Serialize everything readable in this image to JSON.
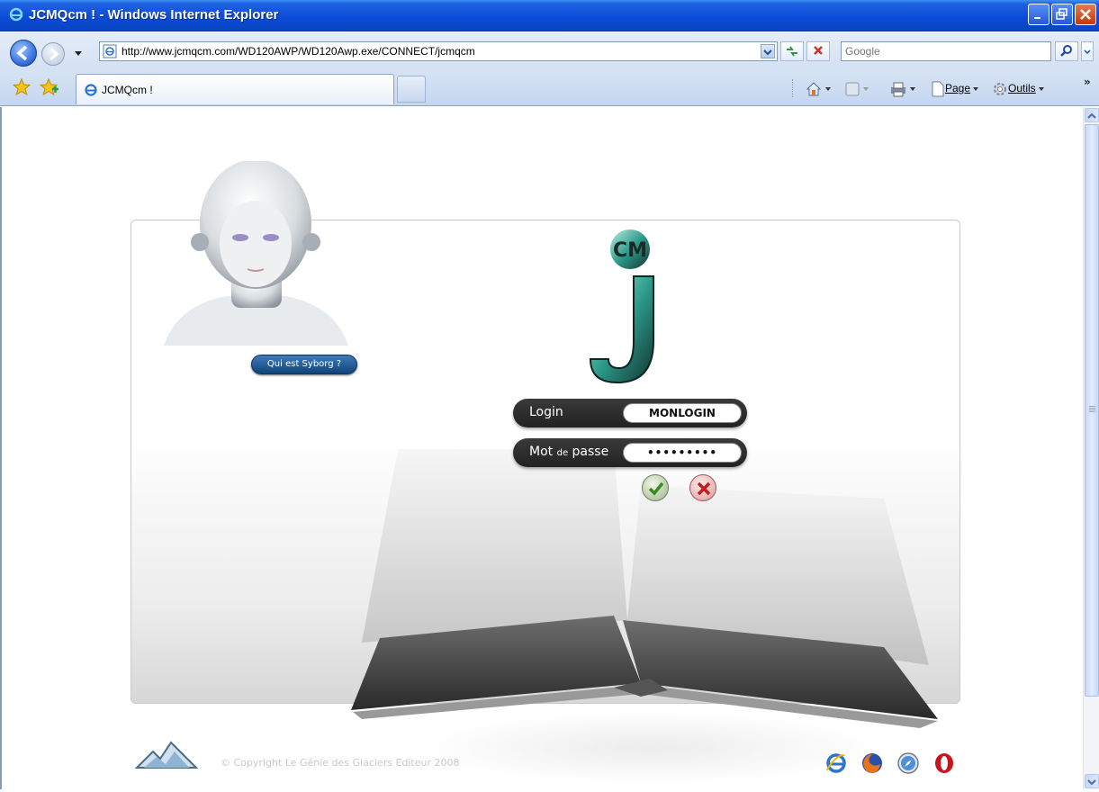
{
  "window": {
    "title": "JCMQcm ! - Windows Internet Explorer"
  },
  "address": {
    "url": "http://www.jcmqcm.com/WD120AWP/WD120Awp.exe/CONNECT/jcmqcm",
    "search_placeholder": "Google"
  },
  "tabs": [
    {
      "label": "JCMQcm !"
    }
  ],
  "commandbar": {
    "page": "Page",
    "tools": "Outils",
    "more": "»"
  },
  "page": {
    "syborg_button": "Qui est Syborg ?",
    "login_label": "Login",
    "login_value": "MONLOGIN",
    "password_label_main": "Mot",
    "password_label_small": "de",
    "password_label_end": "passe",
    "password_value": "•••••••••",
    "copyright": "© Copyright Le Génie des Glaciers Editeur 2008"
  },
  "colors": {
    "titlebar": "#0a4bd6",
    "accent_button": "#0e4478",
    "pill": "#2a2a2a"
  },
  "icons": [
    "ie-icon",
    "back-icon",
    "forward-icon",
    "refresh-icon",
    "stop-icon",
    "search-icon",
    "favorites-star-icon",
    "add-favorite-icon",
    "home-icon",
    "feeds-icon",
    "print-icon",
    "page-icon",
    "tools-gear-icon",
    "checkmark-icon",
    "cross-icon",
    "firefox-icon",
    "safari-icon",
    "opera-icon",
    "glacier-logo-icon"
  ]
}
